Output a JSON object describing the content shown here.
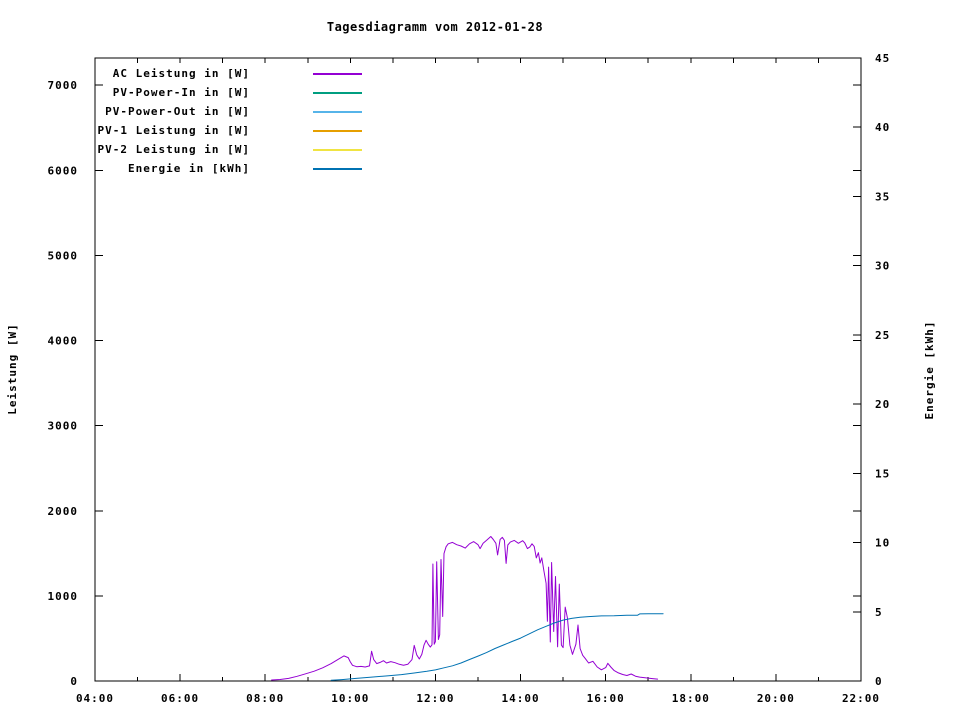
{
  "title": "Tagesdiagramm vom 2012-01-28",
  "chart_data": {
    "type": "line",
    "title": "Tagesdiagramm vom 2012-01-28",
    "grid": false,
    "legend_position": "top-left-inside",
    "x_axis": {
      "min": 4,
      "max": 22,
      "major_ticks": [
        4,
        6,
        8,
        10,
        12,
        14,
        16,
        18,
        20,
        22
      ],
      "major_labels": [
        "04:00",
        "06:00",
        "08:00",
        "10:00",
        "12:00",
        "14:00",
        "16:00",
        "18:00",
        "20:00",
        "22:00"
      ],
      "minor_ticks": [
        5,
        7,
        9,
        11,
        13,
        15,
        17,
        19,
        21
      ]
    },
    "left_axis": {
      "title": "Leistung [W]",
      "min": 0,
      "max": 7320,
      "ticks": [
        0,
        1000,
        2000,
        3000,
        4000,
        5000,
        6000,
        7000
      ],
      "labels": [
        "0",
        "1000",
        "2000",
        "3000",
        "4000",
        "5000",
        "6000",
        "7000"
      ]
    },
    "right_axis": {
      "title": "Energie [kWh]",
      "min": 0,
      "max": 45,
      "ticks": [
        0,
        5,
        10,
        15,
        20,
        25,
        30,
        35,
        40,
        45
      ],
      "labels": [
        "0",
        "5",
        "10",
        "15",
        "20",
        "25",
        "30",
        "35",
        "40",
        "45"
      ]
    },
    "series": [
      {
        "name": "AC Leistung in [W]",
        "color": "#9400d3",
        "axis": "left",
        "points": [
          [
            8.15,
            12
          ],
          [
            8.35,
            18
          ],
          [
            8.55,
            30
          ],
          [
            8.75,
            55
          ],
          [
            8.95,
            85
          ],
          [
            9.15,
            115
          ],
          [
            9.35,
            155
          ],
          [
            9.55,
            205
          ],
          [
            9.7,
            250
          ],
          [
            9.85,
            295
          ],
          [
            9.95,
            275
          ],
          [
            10.0,
            225
          ],
          [
            10.05,
            185
          ],
          [
            10.15,
            168
          ],
          [
            10.25,
            172
          ],
          [
            10.35,
            165
          ],
          [
            10.45,
            178
          ],
          [
            10.5,
            350
          ],
          [
            10.55,
            252
          ],
          [
            10.62,
            205
          ],
          [
            10.7,
            218
          ],
          [
            10.78,
            238
          ],
          [
            10.85,
            212
          ],
          [
            10.95,
            228
          ],
          [
            11.05,
            215
          ],
          [
            11.15,
            196
          ],
          [
            11.25,
            186
          ],
          [
            11.35,
            196
          ],
          [
            11.45,
            252
          ],
          [
            11.5,
            418
          ],
          [
            11.56,
            308
          ],
          [
            11.62,
            258
          ],
          [
            11.68,
            312
          ],
          [
            11.73,
            422
          ],
          [
            11.78,
            478
          ],
          [
            11.83,
            432
          ],
          [
            11.88,
            398
          ],
          [
            11.92,
            425
          ],
          [
            11.94,
            1375
          ],
          [
            11.97,
            432
          ],
          [
            12.0,
            462
          ],
          [
            12.03,
            1402
          ],
          [
            12.07,
            488
          ],
          [
            12.1,
            542
          ],
          [
            12.13,
            1428
          ],
          [
            12.17,
            758
          ],
          [
            12.2,
            1498
          ],
          [
            12.25,
            1578
          ],
          [
            12.3,
            1612
          ],
          [
            12.4,
            1628
          ],
          [
            12.5,
            1602
          ],
          [
            12.6,
            1586
          ],
          [
            12.7,
            1562
          ],
          [
            12.8,
            1612
          ],
          [
            12.9,
            1638
          ],
          [
            13.0,
            1602
          ],
          [
            13.05,
            1556
          ],
          [
            13.12,
            1618
          ],
          [
            13.2,
            1652
          ],
          [
            13.3,
            1698
          ],
          [
            13.36,
            1662
          ],
          [
            13.42,
            1618
          ],
          [
            13.46,
            1482
          ],
          [
            13.52,
            1662
          ],
          [
            13.57,
            1688
          ],
          [
            13.62,
            1652
          ],
          [
            13.66,
            1382
          ],
          [
            13.7,
            1598
          ],
          [
            13.76,
            1632
          ],
          [
            13.85,
            1652
          ],
          [
            13.95,
            1618
          ],
          [
            14.05,
            1648
          ],
          [
            14.1,
            1622
          ],
          [
            14.16,
            1556
          ],
          [
            14.22,
            1576
          ],
          [
            14.27,
            1612
          ],
          [
            14.32,
            1582
          ],
          [
            14.37,
            1446
          ],
          [
            14.42,
            1508
          ],
          [
            14.46,
            1386
          ],
          [
            14.5,
            1446
          ],
          [
            14.55,
            1288
          ],
          [
            14.6,
            1148
          ],
          [
            14.63,
            702
          ],
          [
            14.66,
            1338
          ],
          [
            14.7,
            458
          ],
          [
            14.73,
            1392
          ],
          [
            14.78,
            582
          ],
          [
            14.82,
            1228
          ],
          [
            14.87,
            402
          ],
          [
            14.91,
            1138
          ],
          [
            14.96,
            422
          ],
          [
            15.0,
            392
          ],
          [
            15.05,
            868
          ],
          [
            15.1,
            742
          ],
          [
            15.16,
            422
          ],
          [
            15.22,
            312
          ],
          [
            15.3,
            432
          ],
          [
            15.35,
            658
          ],
          [
            15.4,
            382
          ],
          [
            15.46,
            302
          ],
          [
            15.52,
            265
          ],
          [
            15.6,
            212
          ],
          [
            15.7,
            232
          ],
          [
            15.8,
            165
          ],
          [
            15.9,
            132
          ],
          [
            16.0,
            158
          ],
          [
            16.05,
            208
          ],
          [
            16.12,
            165
          ],
          [
            16.2,
            122
          ],
          [
            16.3,
            95
          ],
          [
            16.4,
            76
          ],
          [
            16.5,
            65
          ],
          [
            16.6,
            82
          ],
          [
            16.7,
            56
          ],
          [
            16.8,
            46
          ],
          [
            16.9,
            40
          ],
          [
            17.0,
            34
          ],
          [
            17.1,
            28
          ],
          [
            17.22,
            22
          ]
        ]
      },
      {
        "name": "PV-Power-In in [W]",
        "color": "#009e80",
        "axis": "left",
        "points": []
      },
      {
        "name": "PV-Power-Out in [W]",
        "color": "#56b4e9",
        "axis": "left",
        "points": []
      },
      {
        "name": "PV-1 Leistung in [W]",
        "color": "#e69f00",
        "axis": "left",
        "points": []
      },
      {
        "name": "PV-2 Leistung in [W]",
        "color": "#f0e442",
        "axis": "left",
        "points": []
      },
      {
        "name": "Energie in [kWh]",
        "color": "#0072b2",
        "axis": "right",
        "points": [
          [
            9.55,
            0.05
          ],
          [
            9.8,
            0.1
          ],
          [
            10.1,
            0.18
          ],
          [
            10.5,
            0.28
          ],
          [
            10.9,
            0.38
          ],
          [
            11.2,
            0.46
          ],
          [
            11.5,
            0.58
          ],
          [
            11.8,
            0.7
          ],
          [
            12.0,
            0.8
          ],
          [
            12.2,
            0.95
          ],
          [
            12.4,
            1.1
          ],
          [
            12.6,
            1.3
          ],
          [
            12.8,
            1.55
          ],
          [
            13.0,
            1.8
          ],
          [
            13.2,
            2.05
          ],
          [
            13.4,
            2.35
          ],
          [
            13.6,
            2.6
          ],
          [
            13.8,
            2.85
          ],
          [
            14.0,
            3.1
          ],
          [
            14.2,
            3.4
          ],
          [
            14.4,
            3.7
          ],
          [
            14.6,
            3.95
          ],
          [
            14.8,
            4.2
          ],
          [
            15.0,
            4.4
          ],
          [
            15.2,
            4.52
          ],
          [
            15.4,
            4.6
          ],
          [
            15.6,
            4.65
          ],
          [
            15.9,
            4.7
          ],
          [
            16.2,
            4.72
          ],
          [
            16.5,
            4.75
          ],
          [
            16.75,
            4.75
          ],
          [
            16.8,
            4.85
          ],
          [
            17.0,
            4.86
          ],
          [
            17.35,
            4.86
          ]
        ]
      }
    ]
  }
}
